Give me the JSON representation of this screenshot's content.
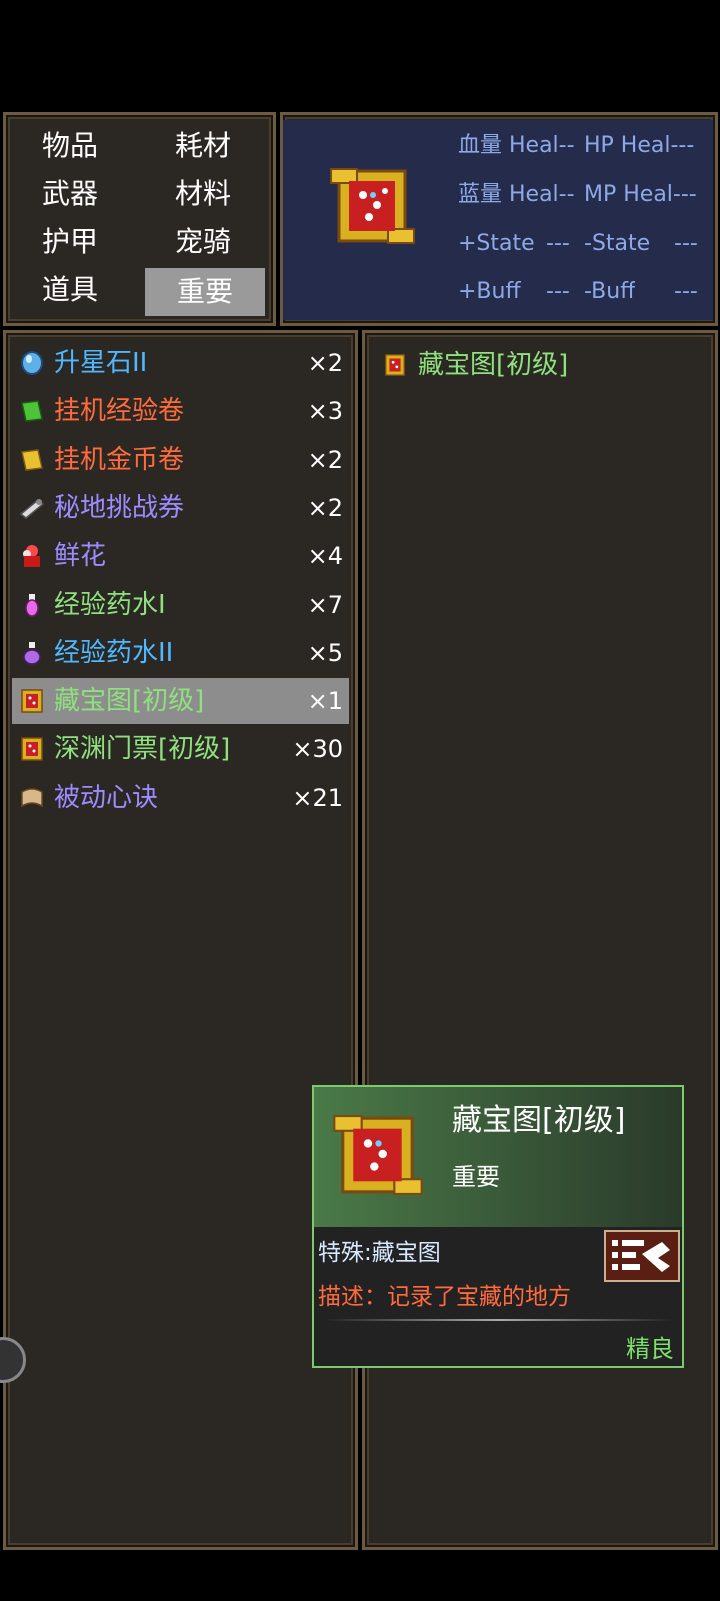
{
  "categories": [
    {
      "label": "物品"
    },
    {
      "label": "耗材"
    },
    {
      "label": "武器"
    },
    {
      "label": "材料"
    },
    {
      "label": "护甲"
    },
    {
      "label": "宠骑"
    },
    {
      "label": "道具"
    },
    {
      "label": "重要",
      "selected": true
    }
  ],
  "stats": {
    "hp_label": "血量 Heal",
    "hp_val": "--",
    "hp2_label": "HP Heal",
    "hp2_val": "---",
    "mp_label": "蓝量 Heal",
    "mp_val": "--",
    "mp2_label": "MP Heal",
    "mp2_val": "---",
    "state_plus": "+State",
    "state_plus_val": "---",
    "state_minus": "-State",
    "state_minus_val": "---",
    "buff_plus": "+Buff",
    "buff_plus_val": "---",
    "buff_minus": "-Buff",
    "buff_minus_val": "---"
  },
  "items": [
    {
      "name": "升星石II",
      "count": "×2",
      "color": "#4fb8ff",
      "icon": "blue-gem-icon"
    },
    {
      "name": "挂机经验卷",
      "count": "×3",
      "color": "#ff6b3d",
      "icon": "green-scroll-icon"
    },
    {
      "name": "挂机金币卷",
      "count": "×2",
      "color": "#ff6b3d",
      "icon": "gold-scroll-icon"
    },
    {
      "name": "秘地挑战券",
      "count": "×2",
      "color": "#9c8cff",
      "icon": "ticket-scroll-icon"
    },
    {
      "name": "鲜花",
      "count": "×4",
      "color": "#9c8cff",
      "icon": "flower-icon"
    },
    {
      "name": "经验药水I",
      "count": "×7",
      "color": "#8fe07e",
      "icon": "potion-pink-icon"
    },
    {
      "name": "经验药水II",
      "count": "×5",
      "color": "#4fb8ff",
      "icon": "potion-purple-icon"
    },
    {
      "name": "藏宝图[初级]",
      "count": "×1",
      "color": "#8fe07e",
      "icon": "treasure-map-icon",
      "selected": true
    },
    {
      "name": "深渊门票[初级]",
      "count": "×30",
      "color": "#8fe07e",
      "icon": "treasure-map-icon"
    },
    {
      "name": "被动心诀",
      "count": "×21",
      "color": "#9c8cff",
      "icon": "parchment-icon"
    }
  ],
  "detail": {
    "name": "藏宝图[初级]"
  },
  "tooltip": {
    "title": "藏宝图[初级]",
    "category": "重要",
    "special": "特殊:藏宝图",
    "description": "描述：记录了宝藏的地方",
    "quality": "精良"
  },
  "colors": {
    "panel_bg": "#2b2824",
    "stat_bg": "#252b4a",
    "stat_text": "#8ea9e8",
    "selected_row": "#8d8d8d",
    "tooltip_border": "#7acc6a"
  }
}
